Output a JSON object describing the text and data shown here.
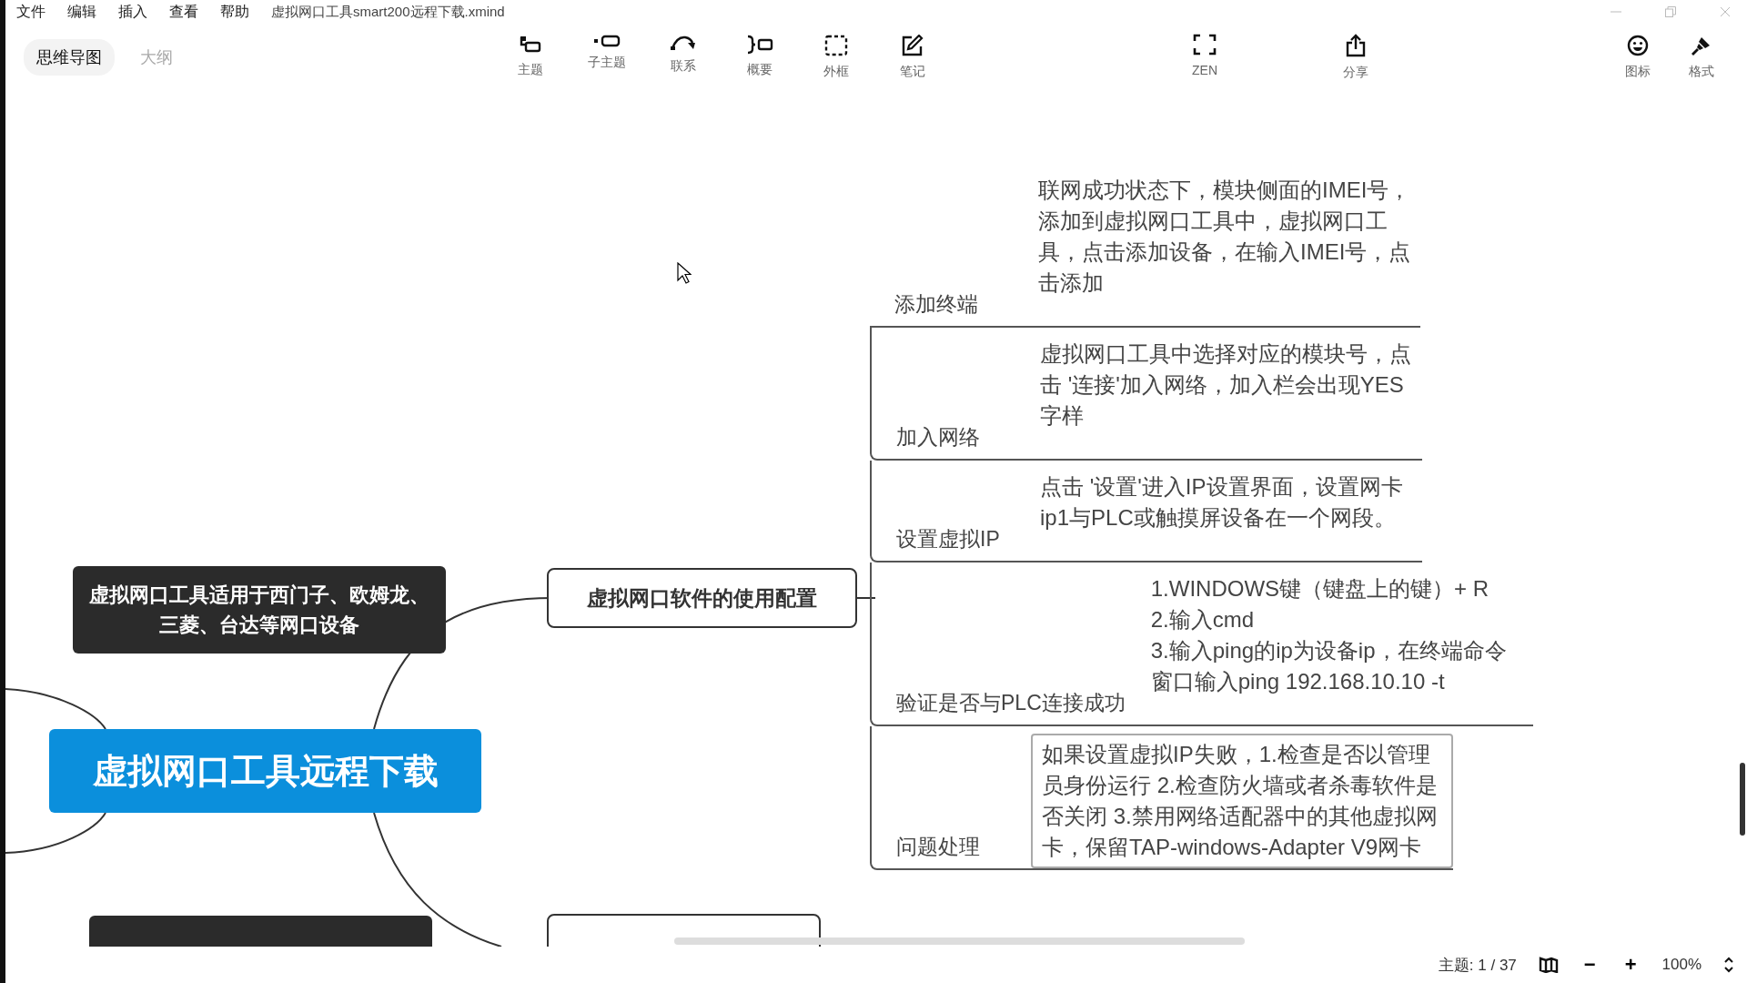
{
  "menu": [
    "文件",
    "编辑",
    "插入",
    "查看",
    "帮助"
  ],
  "document_title": "虚拟网口工具smart200远程下载.xmind",
  "view_tabs": [
    {
      "label": "思维导图",
      "selected": true
    },
    {
      "label": "大纲",
      "selected": false
    }
  ],
  "toolbar": [
    {
      "kind": "topic",
      "label": "主题"
    },
    {
      "kind": "subtopic",
      "label": "子主题"
    },
    {
      "kind": "relationship",
      "label": "联系"
    },
    {
      "kind": "summary",
      "label": "概要"
    },
    {
      "kind": "boundary",
      "label": "外框"
    },
    {
      "kind": "note",
      "label": "笔记"
    }
  ],
  "toolbar_right": [
    {
      "kind": "zen",
      "label": "ZEN"
    },
    {
      "kind": "share",
      "label": "分享"
    }
  ],
  "panel_toggles": [
    {
      "kind": "icon",
      "label": "图标"
    },
    {
      "kind": "format",
      "label": "格式"
    }
  ],
  "mindmap": {
    "central_topic": "虚拟网口工具远程下载",
    "dark_topic": "虚拟网口工具适用于西门子、欧姆龙、三菱、台达等网口设备",
    "config_topic": "虚拟网口软件的使用配置",
    "subtopics": [
      {
        "label": "添加终端",
        "note": "联网成功状态下，模块侧面的IMEI号，添加到虚拟网口工具中，虚拟网口工具，点击添加设备，在输入IMEI号，点击添加",
        "framed": false
      },
      {
        "label": "加入网络",
        "note": "虚拟网口工具中选择对应的模块号，点击 '连接'加入网络，加入栏会出现YES字样",
        "framed": false
      },
      {
        "label": "设置虚拟IP",
        "note": "点击 '设置'进入IP设置界面，设置网卡ip1与PLC或触摸屏设备在一个网段。",
        "framed": false
      },
      {
        "label": "验证是否与PLC连接成功",
        "note": "1.WINDOWS键（键盘上的键）+ R\n2.输入cmd\n3.输入ping的ip为设备ip，在终端命令窗口输入ping 192.168.10.10 -t",
        "framed": false
      },
      {
        "label": "问题处理",
        "note": "如果设置虚拟IP失败，1.检查是否以管理员身份运行 2.检查防火墙或者杀毒软件是否关闭 3.禁用网络适配器中的其他虚拟网卡，保留TAP-windows-Adapter V9网卡",
        "framed": true
      }
    ]
  },
  "status_bar": {
    "topic_count": "主题: 1 / 37",
    "zoom_out": "−",
    "zoom_in": "+",
    "zoom": "100%"
  }
}
